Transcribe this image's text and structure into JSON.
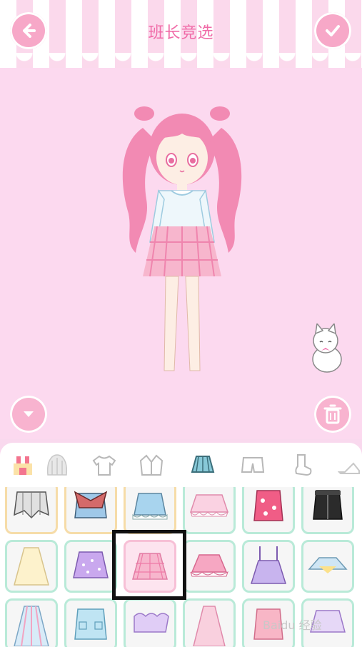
{
  "header": {
    "title": "班长竞选"
  },
  "icons": {
    "back": "arrow-left-icon",
    "confirm": "checkmark-icon",
    "collapse": "chevron-down-icon",
    "delete": "trash-icon"
  },
  "tabs": [
    {
      "name": "shop",
      "active": false
    },
    {
      "name": "hair",
      "active": false
    },
    {
      "name": "tshirt",
      "active": false
    },
    {
      "name": "jacket",
      "active": false
    },
    {
      "name": "skirt",
      "active": true
    },
    {
      "name": "shorts",
      "active": false
    },
    {
      "name": "socks",
      "active": false
    },
    {
      "name": "shoes",
      "active": false
    }
  ],
  "selected_item": "pink-plaid-skirt",
  "watermark": "Baidu 经验",
  "colors": {
    "accent": "#f06aa7",
    "button": "#f7a8c8",
    "cell_border": "#b9ead8",
    "cell_locked_border": "#f6dca8"
  }
}
